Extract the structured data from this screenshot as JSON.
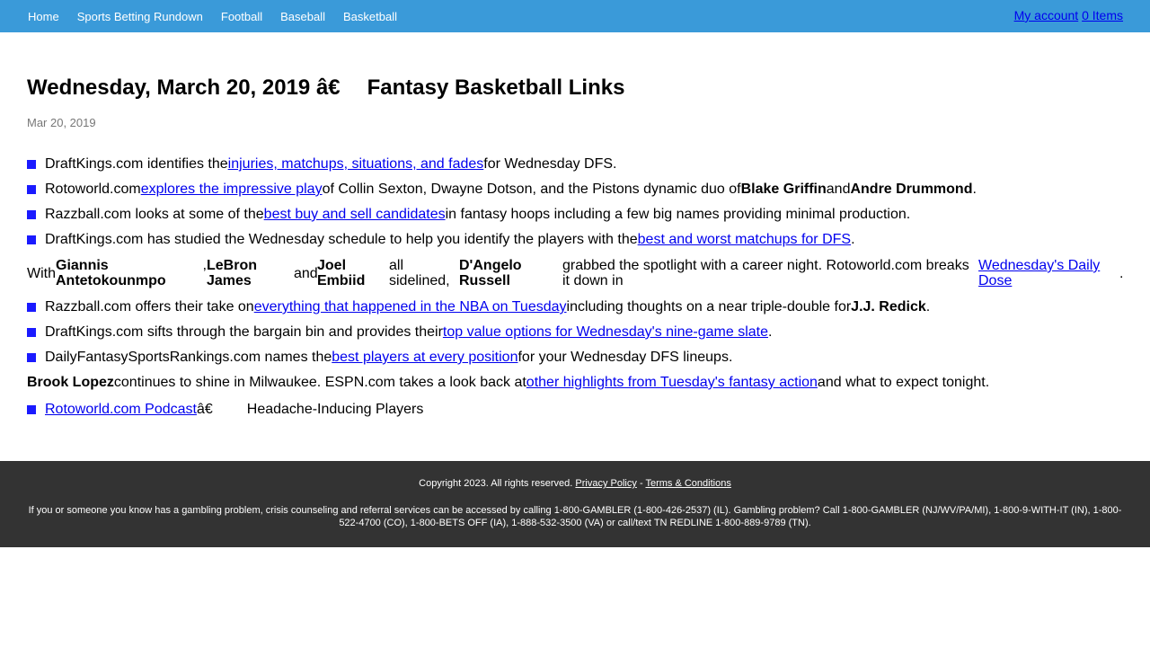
{
  "nav": {
    "links": [
      "Home",
      "Sports Betting Rundown",
      "Football",
      "Baseball",
      "Basketball"
    ],
    "account": "My account",
    "items": "0 Items"
  },
  "article": {
    "title_left": "Wednesday, March 20, 2019 â€",
    "title_right": "Fantasy Basketball Links",
    "date": "Mar 20, 2019",
    "items": [
      {
        "pre": "DraftKings.com identifies the",
        "link": "injuries, matchups, situations, and fades",
        "post": "for Wednesday DFS."
      },
      {
        "pre": "Rotoworld.com",
        "link": "explores the impressive play",
        "post": "of Collin Sexton, Dwayne Dotson, and the Pistons dynamic duo of",
        "b1": "Blake Griffin",
        "mid": "and",
        "b2": "Andre Drummond",
        "end": "."
      },
      {
        "pre": "Razzball.com looks at some of the",
        "link": "best buy and sell candidates",
        "post": "in fantasy hoops including a few big names providing minimal production."
      },
      {
        "pre": "DraftKings.com has studied the Wednesday schedule to help you identify the players with the",
        "link": "best and worst matchups for DFS",
        "post": "."
      },
      {
        "c1": "With",
        "c2": "Giannis Antetokounmpo",
        "c3": "’",
        "c4": "LeBron James",
        "c5": "and",
        "c6": "Joel Embiid",
        "c7": "all sidelined,",
        "c8": "D'Angelo Russell",
        "c9": "grabbed the spotlight with a career night. Rotoworld.com breaks it down in",
        "c10": "Wednesday's Daily Dose",
        "c11": "."
      },
      {
        "pre": "Razzball.com offers their take on",
        "link": "everything that happened in the NBA on Tuesday",
        "post": "including thoughts on a near triple-double for",
        "b1": "J.J. Redick",
        "end": "."
      },
      {
        "pre": "DraftKings.com sifts through the bargain bin and provides their",
        "link": "top value options for Wednesday's nine-game slate",
        "post": "."
      },
      {
        "pre": "DailyFantasySportsRankings.com names the",
        "link": "best players at every position",
        "post": "for your Wednesday DFS lineups."
      },
      {
        "b0": "Brook Lopez",
        "pre": "continues to shine in Milwaukee. ESPN.com takes a look back at",
        "link": "other highlights from Tuesday's fantasy action",
        "post": "and what to expect tonight."
      },
      {
        "link": "Rotoworld.com Podcast",
        "post": "â€",
        "post2": "Headache-Inducing Players"
      }
    ]
  },
  "footer": {
    "copyright": "Copyright 2023. All rights reserved.",
    "privacy": "Privacy Policy",
    "dash": "-",
    "terms": "Terms & Conditions",
    "gambling": "If you or someone you know has a gambling problem, crisis counseling and referral services can be accessed by calling 1-800-GAMBLER (1-800-426-2537) (IL). Gambling problem? Call 1-800-GAMBLER (NJ/WV/PA/MI), 1-800-9-WITH-IT (IN), 1-800-522-4700 (CO), 1-800-BETS OFF (IA), 1-888-532-3500 (VA) or call/text TN REDLINE 1-800-889-9789 (TN)."
  },
  "colors": {
    "topbar": "#3a9ad9",
    "bullet": "#1a1aff",
    "footer": "#333333",
    "link": "#0000ee"
  }
}
